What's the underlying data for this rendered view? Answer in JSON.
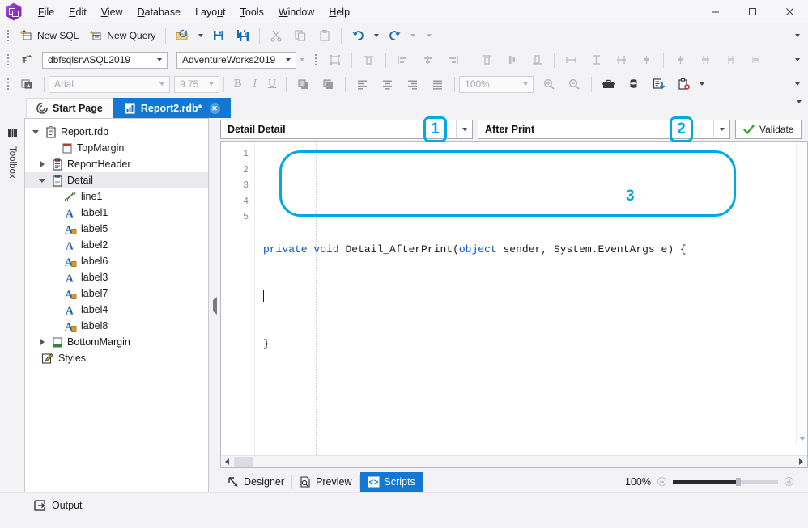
{
  "window": {
    "logo_name": "app-logo",
    "minimize": "—",
    "maximize": "□",
    "close": "✕"
  },
  "menubar": {
    "items": [
      {
        "label": "File",
        "accel": "F"
      },
      {
        "label": "Edit",
        "accel": "E"
      },
      {
        "label": "View",
        "accel": "V"
      },
      {
        "label": "Database",
        "accel": "D"
      },
      {
        "label": "Layout",
        "accel": "u"
      },
      {
        "label": "Tools",
        "accel": "T"
      },
      {
        "label": "Window",
        "accel": "W"
      },
      {
        "label": "Help",
        "accel": "H"
      }
    ]
  },
  "toolbar_main": {
    "new_sql": "New SQL",
    "new_query": "New Query",
    "open_icon": "open-folder-icon",
    "save_icon": "save-icon",
    "save_all_icon": "save-all-icon",
    "cut_icon": "cut-icon",
    "copy_icon": "copy-icon",
    "paste_icon": "paste-icon",
    "undo_icon": "undo-icon",
    "redo_icon": "redo-icon"
  },
  "toolbar_db": {
    "connect_icon": "connect-icon",
    "server": "dbfsqlsrv\\SQL2019",
    "database": "AdventureWorks2019",
    "align_icons": [
      "select-all-icon",
      "align-to-grid-icon",
      "align-left-icon",
      "align-center-icon",
      "align-right-icon",
      "align-top-icon",
      "align-middle-icon",
      "align-bottom-icon",
      "make-same-width-icon",
      "make-same-height-icon",
      "make-same-size-icon",
      "size-to-grid-icon",
      "horizontal-spacing-equal-icon",
      "horizontal-spacing-increase-icon",
      "horizontal-spacing-decrease-icon",
      "horizontal-spacing-remove-icon"
    ]
  },
  "toolbar_format": {
    "style_icon": "style-icon",
    "font_family": "Arial",
    "font_size": "9.75",
    "bold": "B",
    "italic": "I",
    "underline": "U",
    "bring_front_icon": "bring-to-front-icon",
    "send_back_icon": "send-to-back-icon",
    "text_align_left_icon": "text-align-left-icon",
    "text_align_center_icon": "text-align-center-icon",
    "text_align_right_icon": "text-align-right-icon",
    "text_align_justify_icon": "text-align-justify-icon",
    "zoom_value": "100%",
    "zoom_in_icon": "zoom-in-icon",
    "zoom_out_icon": "zoom-out-icon",
    "toolbox_icon": "toolbox-icon",
    "data_icon": "database-icon",
    "report_icon": "report-download-icon",
    "clipboard_error_icon": "clipboard-error-icon"
  },
  "tabs": [
    {
      "label": "Start Page",
      "icon": "start-page-icon",
      "active": false,
      "closable": false
    },
    {
      "label": "Report2.rdb*",
      "icon": "report-file-icon",
      "active": true,
      "closable": true
    }
  ],
  "dock_left": {
    "toolbox_label": "Toolbox",
    "toolbox_icon": "toolbox-panel-icon"
  },
  "tree": {
    "nodes": [
      {
        "label": "Report.rdb",
        "indent": 0,
        "expander": "down",
        "icon": "report-icon",
        "selected": false
      },
      {
        "label": "TopMargin",
        "indent": 1,
        "expander": "none",
        "icon": "top-margin-icon",
        "selected": false
      },
      {
        "label": "ReportHeader",
        "indent": 1,
        "expander": "right",
        "icon": "header-icon",
        "selected": false
      },
      {
        "label": "Detail",
        "indent": 1,
        "expander": "down",
        "icon": "detail-icon",
        "selected": true
      },
      {
        "label": "line1",
        "indent": 2,
        "expander": "none",
        "icon": "line-icon",
        "selected": false
      },
      {
        "label": "label1",
        "indent": 2,
        "expander": "none",
        "icon": "label-icon",
        "selected": false
      },
      {
        "label": "label5",
        "indent": 2,
        "expander": "none",
        "icon": "label-bound-icon",
        "selected": false
      },
      {
        "label": "label2",
        "indent": 2,
        "expander": "none",
        "icon": "label-icon",
        "selected": false
      },
      {
        "label": "label6",
        "indent": 2,
        "expander": "none",
        "icon": "label-bound-icon",
        "selected": false
      },
      {
        "label": "label3",
        "indent": 2,
        "expander": "none",
        "icon": "label-icon",
        "selected": false
      },
      {
        "label": "label7",
        "indent": 2,
        "expander": "none",
        "icon": "label-bound-icon",
        "selected": false
      },
      {
        "label": "label4",
        "indent": 2,
        "expander": "none",
        "icon": "label-icon",
        "selected": false
      },
      {
        "label": "label8",
        "indent": 2,
        "expander": "none",
        "icon": "label-bound-icon",
        "selected": false
      },
      {
        "label": "BottomMargin",
        "indent": 1,
        "expander": "right",
        "icon": "bottom-margin-icon",
        "selected": false
      },
      {
        "label": "Styles",
        "indent": 0,
        "expander": "none",
        "icon": "styles-icon",
        "selected": false
      }
    ]
  },
  "script_editor": {
    "object_selector": "Detail  Detail",
    "event_selector": "After Print",
    "validate_label": "Validate",
    "line_numbers": [
      "1",
      "2",
      "3",
      "4",
      "5"
    ],
    "code_lines": [
      {
        "n": 1,
        "segments": []
      },
      {
        "n": 2,
        "segments": [
          {
            "t": "private",
            "k": true
          },
          {
            "t": " ",
            "k": false
          },
          {
            "t": "void",
            "k": true
          },
          {
            "t": " Detail_AfterPrint(",
            "k": false
          },
          {
            "t": "object",
            "k": true
          },
          {
            "t": " sender, System.EventArgs e) {",
            "k": false
          }
        ]
      },
      {
        "n": 3,
        "segments": []
      },
      {
        "n": 4,
        "segments": [
          {
            "t": "}",
            "k": false
          }
        ]
      },
      {
        "n": 5,
        "segments": []
      }
    ]
  },
  "view_tabs": [
    {
      "label": "Designer",
      "icon": "designer-icon",
      "active": false
    },
    {
      "label": "Preview",
      "icon": "preview-icon",
      "active": false
    },
    {
      "label": "Scripts",
      "icon": "scripts-icon",
      "active": true
    }
  ],
  "status": {
    "zoom": "100%",
    "zoom_out_icon": "zoom-out-slider-icon",
    "zoom_in_icon": "zoom-in-slider-icon"
  },
  "output_panel": {
    "label": "Output",
    "icon": "output-icon"
  },
  "annotations": [
    {
      "id": "1",
      "text": "1"
    },
    {
      "id": "2",
      "text": "2"
    },
    {
      "id": "3",
      "text": "3"
    }
  ],
  "colors": {
    "accent": "#1278d4",
    "annotation": "#00a9e6",
    "keyword": "#0a4fd6",
    "label_icon": "#1f5fb0",
    "bound_badge": "#e8971e"
  }
}
